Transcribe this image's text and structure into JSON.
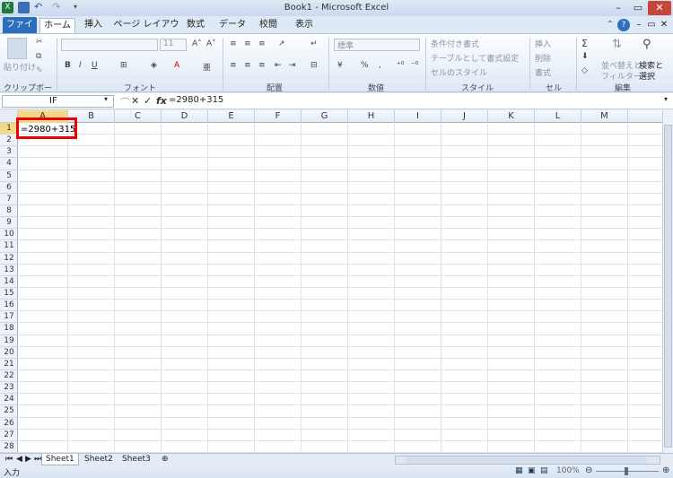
{
  "window": {
    "title": "Book1 - Microsoft Excel"
  },
  "tabs": [
    "ファイル",
    "ホーム",
    "挿入",
    "ページ レイアウト",
    "数式",
    "データ",
    "校閲",
    "表示"
  ],
  "ribbon": {
    "clipboard": {
      "paste": "貼り付け",
      "label": "クリップボード"
    },
    "font": {
      "size": "11",
      "label": "フォント"
    },
    "alignment": {
      "label": "配置"
    },
    "number": {
      "format": "標準",
      "label": "数値"
    },
    "styles": {
      "conditional": "条件付き書式",
      "table": "テーブルとして書式設定",
      "cell": "セルのスタイル",
      "label": "スタイル"
    },
    "cells": {
      "insert": "挿入",
      "delete": "削除",
      "format": "書式",
      "label": "セル"
    },
    "editing": {
      "sort": "並べ替えと",
      "filter": "フィルター",
      "find": "検索と",
      "select": "選択",
      "label": "編集"
    }
  },
  "formula_bar": {
    "name_box": "IF",
    "formula": "=2980+315",
    "fx": "fx"
  },
  "columns": [
    "A",
    "B",
    "C",
    "D",
    "E",
    "F",
    "G",
    "H",
    "I",
    "J",
    "K",
    "L",
    "M"
  ],
  "rows": [
    "1",
    "2",
    "3",
    "4",
    "5",
    "6",
    "7",
    "8",
    "9",
    "10",
    "11",
    "12",
    "13",
    "14",
    "15",
    "16",
    "17",
    "18",
    "19",
    "20",
    "21",
    "22",
    "23",
    "24",
    "25",
    "26",
    "27",
    "28"
  ],
  "cell_a1": "=2980+315",
  "sheets": [
    "Sheet1",
    "Sheet2",
    "Sheet3"
  ],
  "status": {
    "mode": "入力",
    "zoom": "100%"
  },
  "colors": {
    "file_tab": "#2a6ebd",
    "highlight": "#e00000",
    "selection": "#f5d883"
  }
}
